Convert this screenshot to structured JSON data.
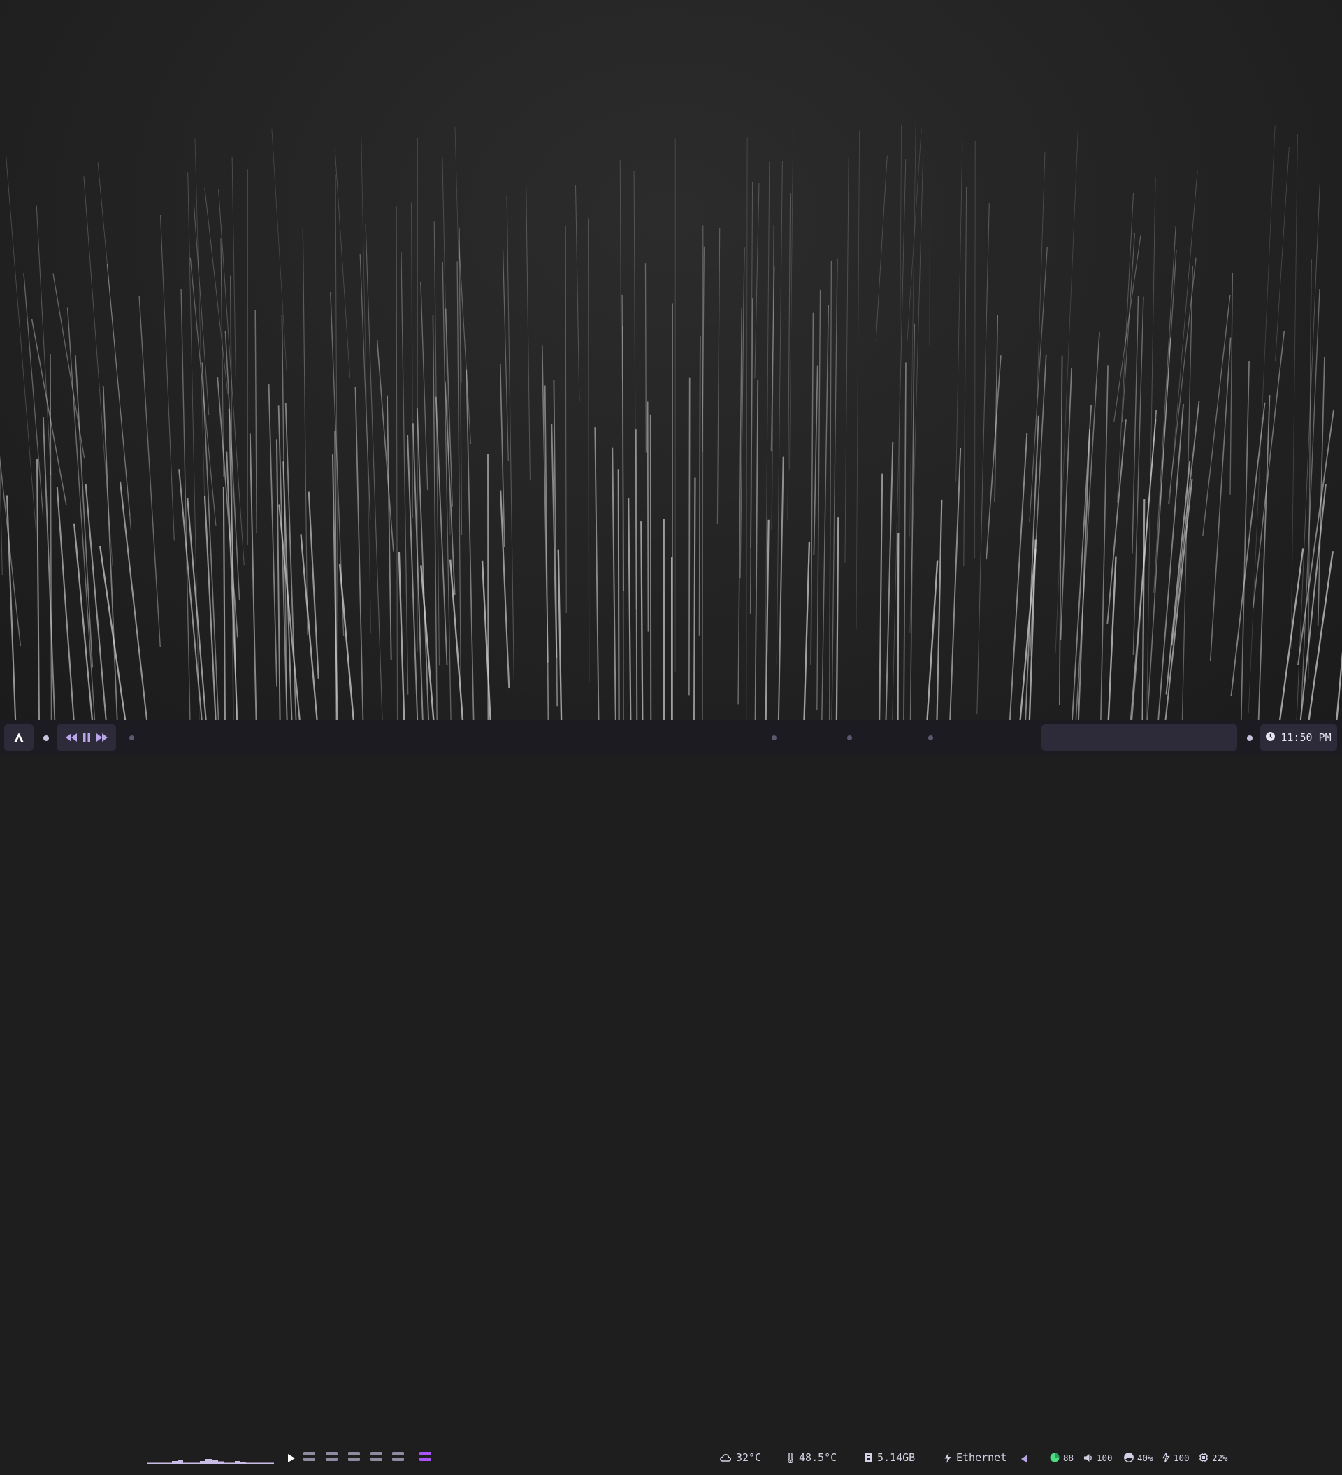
{
  "bar": {
    "launcher_icon": "arch-logo-icon",
    "media": {
      "prev_icon": "rewind-icon",
      "pause_icon": "pause-icon",
      "next_icon": "fast-forward-icon",
      "play_icon": "play-icon"
    },
    "workspaces": {
      "count": 6,
      "active_index": 6,
      "icon": "workspace-icon"
    },
    "weather": {
      "icon": "cloud-icon",
      "value": "32°C"
    },
    "cpu_temp": {
      "icon": "thermometer-icon",
      "value": "48.5°C"
    },
    "memory": {
      "icon": "memory-icon",
      "value": "5.14GB"
    },
    "network": {
      "icon": "lightning-icon",
      "value": "Ethernet",
      "arrow_icon": "triangle-left-icon"
    },
    "tray": {
      "battery": {
        "icon": "battery-icon",
        "value": "88",
        "color": "#4ade80"
      },
      "volume": {
        "icon": "speaker-icon",
        "value": "100"
      },
      "disk": {
        "icon": "pie-icon",
        "value": "40%"
      },
      "brightness": {
        "icon": "brightness-icon",
        "value": "100"
      },
      "cpu": {
        "icon": "cpu-icon",
        "value": "22%"
      }
    },
    "clock": {
      "icon": "clock-icon",
      "value": "11:50 PM"
    }
  },
  "colors": {
    "bar_bg": "#1c1b22",
    "pill_bg": "#2d2a3a",
    "accent": "#a855f7",
    "text": "#d9d4e8",
    "media_icon": "#b9a6e8",
    "battery": "#4ade80"
  }
}
